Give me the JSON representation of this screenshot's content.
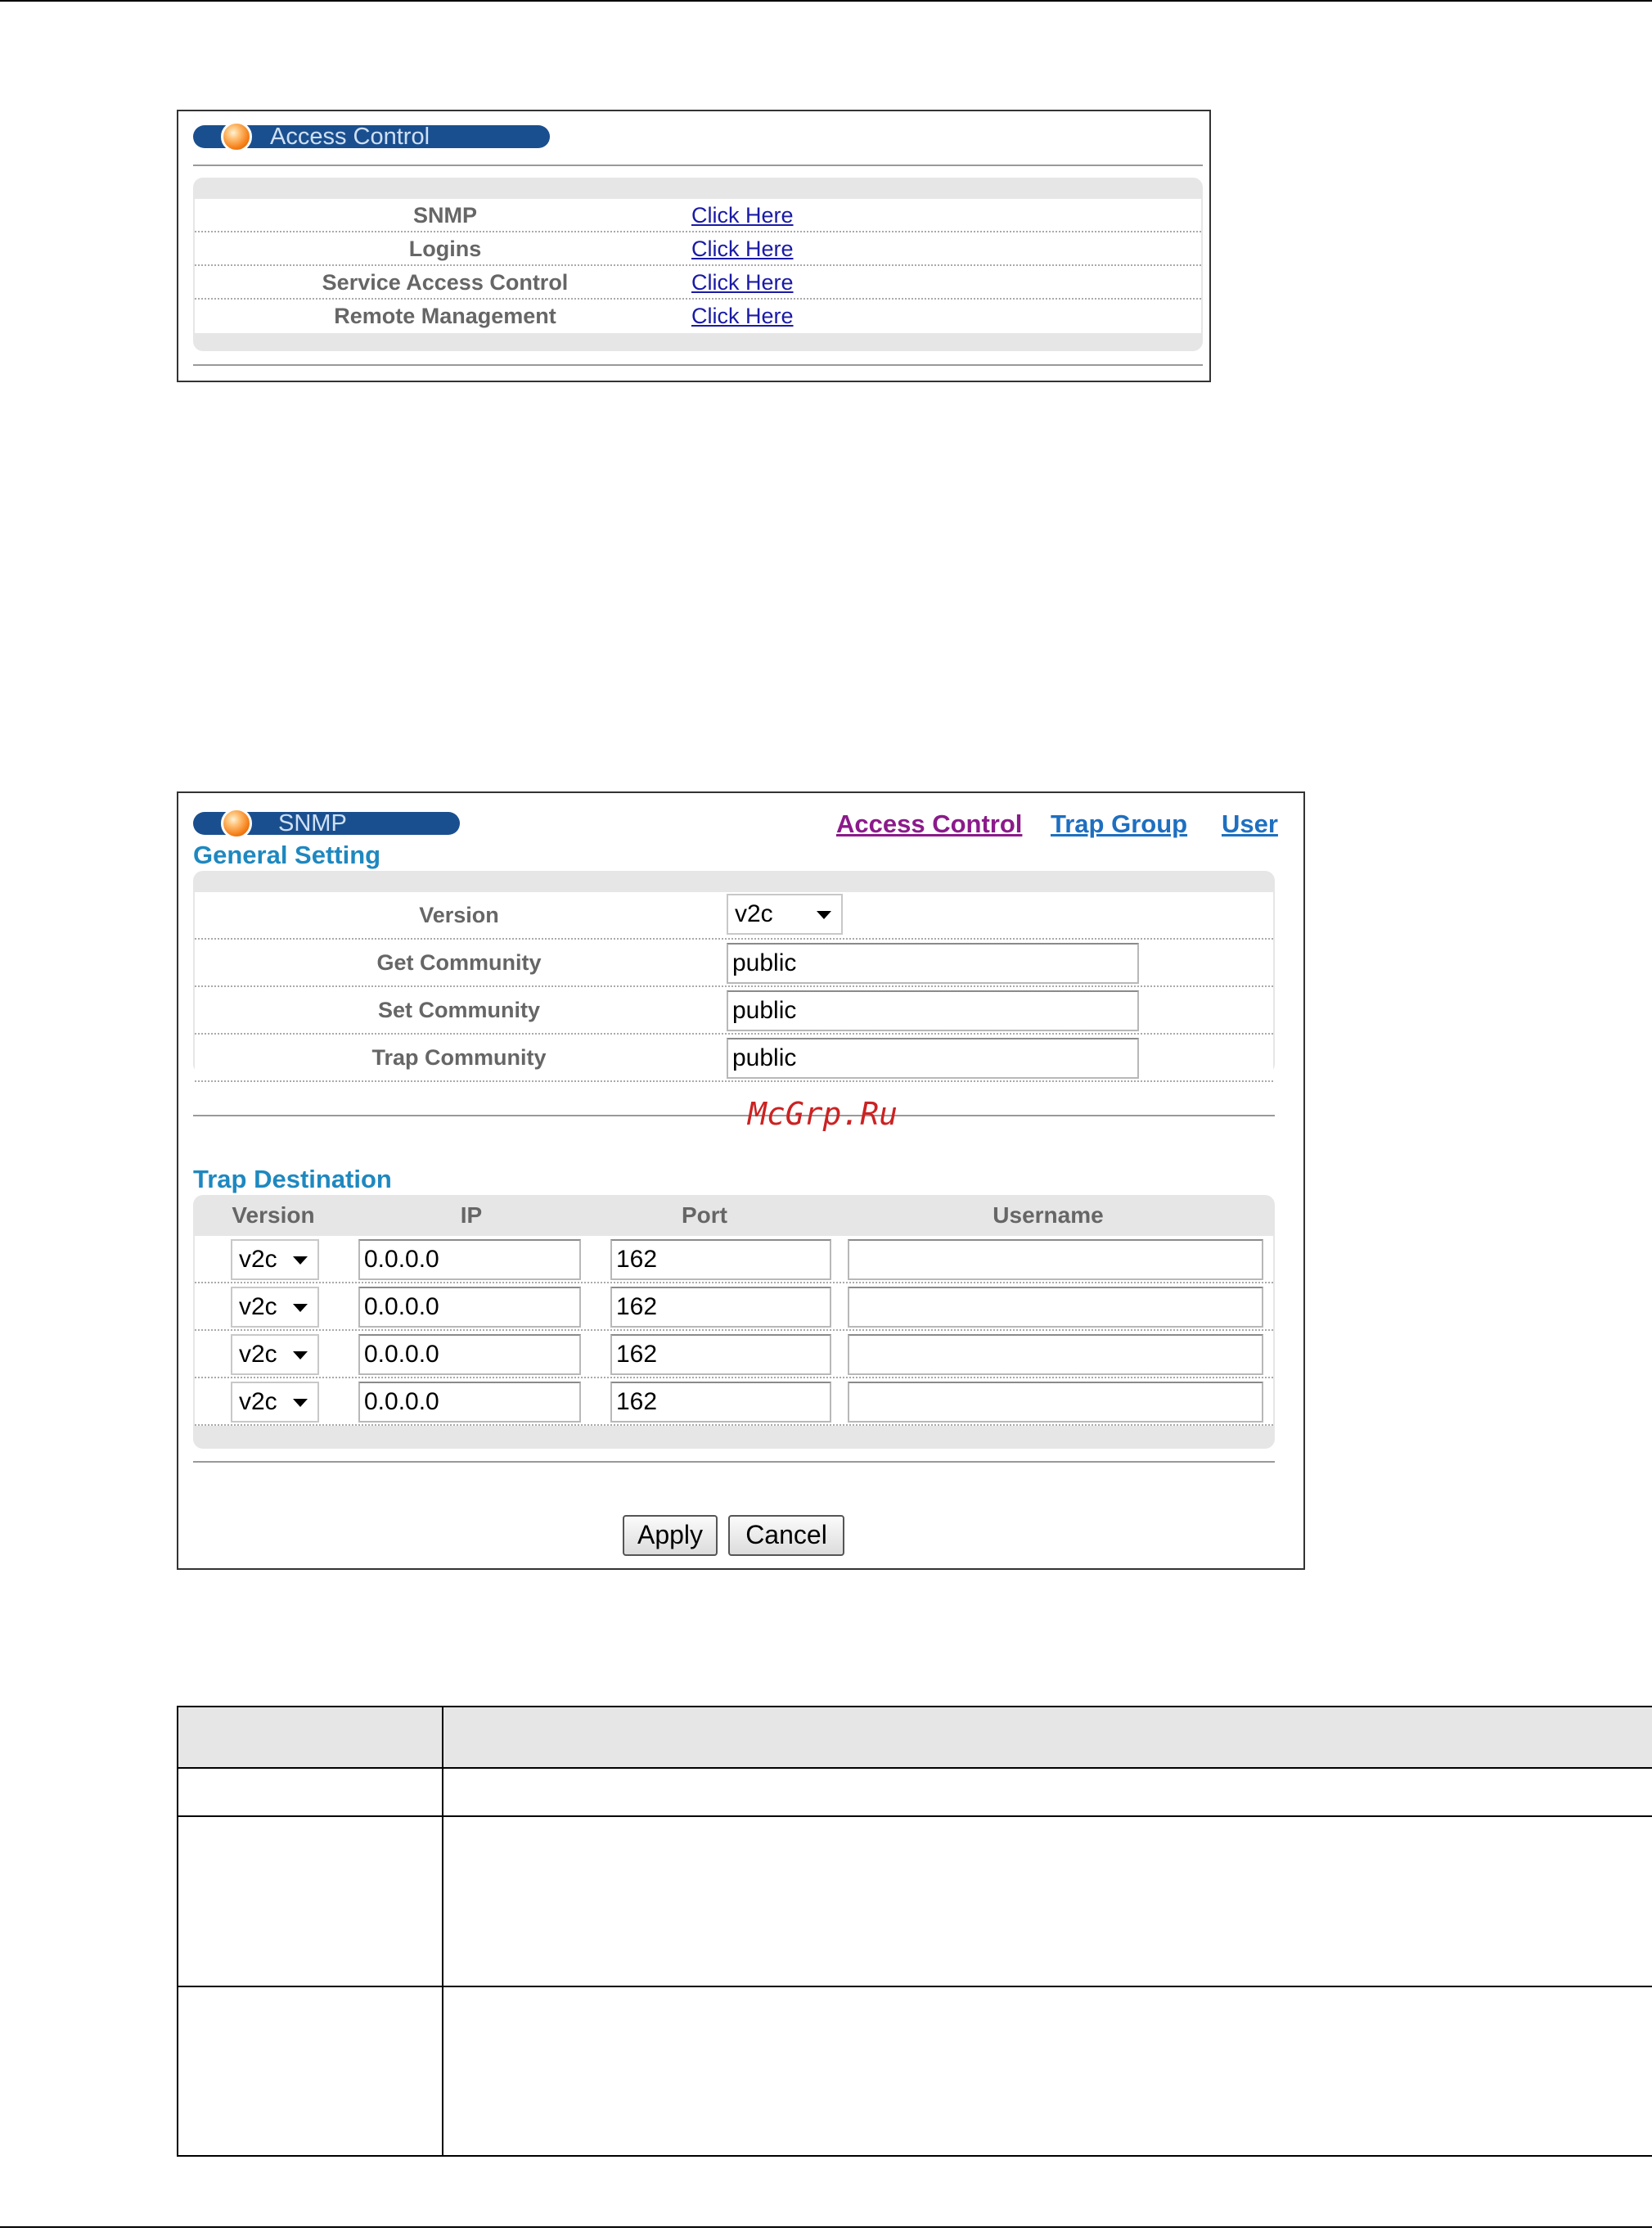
{
  "access_control": {
    "title": "Access Control",
    "rows": [
      {
        "label": "SNMP",
        "link": "Click Here"
      },
      {
        "label": "Logins",
        "link": "Click Here"
      },
      {
        "label": "Service Access Control",
        "link": "Click Here"
      },
      {
        "label": "Remote Management",
        "link": "Click Here"
      }
    ]
  },
  "snmp": {
    "title": "SNMP",
    "nav": {
      "access_control": "Access Control",
      "trap_group": "Trap Group",
      "user": "User"
    },
    "nav_colors": {
      "visited": "#8b1a8b",
      "link": "#1e6fc0"
    },
    "general_setting": {
      "title": "General Setting",
      "version_label": "Version",
      "version_value": "v2c",
      "get_community_label": "Get Community",
      "get_community_value": "public",
      "set_community_label": "Set Community",
      "set_community_value": "public",
      "trap_community_label": "Trap Community",
      "trap_community_value": "public"
    },
    "trap_destination": {
      "title": "Trap Destination",
      "headers": {
        "version": "Version",
        "ip": "IP",
        "port": "Port",
        "username": "Username"
      },
      "rows": [
        {
          "version": "v2c",
          "ip": "0.0.0.0",
          "port": "162",
          "username": ""
        },
        {
          "version": "v2c",
          "ip": "0.0.0.0",
          "port": "162",
          "username": ""
        },
        {
          "version": "v2c",
          "ip": "0.0.0.0",
          "port": "162",
          "username": ""
        },
        {
          "version": "v2c",
          "ip": "0.0.0.0",
          "port": "162",
          "username": ""
        }
      ]
    },
    "buttons": {
      "apply": "Apply",
      "cancel": "Cancel"
    }
  },
  "watermark": "McGrp.Ru"
}
